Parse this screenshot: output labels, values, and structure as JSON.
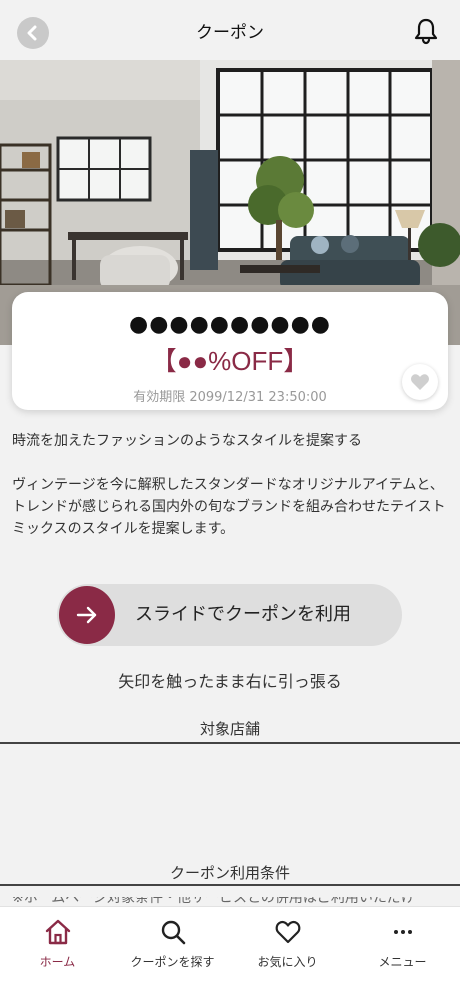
{
  "header": {
    "title": "クーポン",
    "back_icon": "chevron-left-icon",
    "bell_icon": "bell-icon"
  },
  "coupon": {
    "name": "●●●●●●●●●●",
    "discount": "【●●%OFF】",
    "expiry": "有効期限 2099/12/31 23:50:00",
    "favorite_icon": "heart-icon"
  },
  "description": {
    "paragraph1": "時流を加えたファッションのようなスタイルを提案する",
    "paragraph2": "ヴィンテージを今に解釈したスタンダードなオリジナルアイテムと、トレンドが感じられる国内外の旬なブランドを組み合わせたテイストミックスのスタイルを提案します。"
  },
  "slider": {
    "label": "スライドでクーポンを利用",
    "hint": "矢印を触ったまま右に引っ張る",
    "icon": "arrow-right-icon"
  },
  "sections": {
    "target_stores": "対象店舗",
    "conditions": "クーポン利用条件",
    "conditions_clipped_text": "※ホームページ対象条件・他サービスとの併用はご利用いただけ"
  },
  "tabs": [
    {
      "label": "ホーム",
      "icon": "home-icon",
      "active": true
    },
    {
      "label": "クーポンを探す",
      "icon": "search-icon",
      "active": false
    },
    {
      "label": "お気に入り",
      "icon": "heart-icon",
      "active": false
    },
    {
      "label": "メニュー",
      "icon": "more-icon",
      "active": false
    }
  ],
  "colors": {
    "accent": "#8a2a46",
    "background": "#f2f2f2"
  }
}
